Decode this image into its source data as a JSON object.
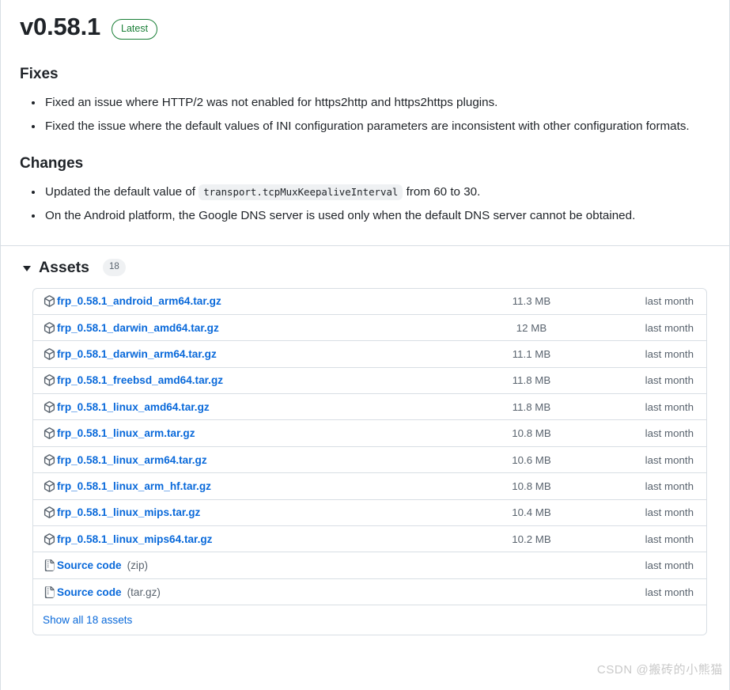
{
  "release": {
    "version": "v0.58.1",
    "badge": "Latest"
  },
  "sections": [
    {
      "heading": "Fixes",
      "items": [
        {
          "text": "Fixed an issue where HTTP/2 was not enabled for https2http and https2https plugins."
        },
        {
          "text": "Fixed the issue where the default values of INI configuration parameters are inconsistent with other configuration formats."
        }
      ]
    },
    {
      "heading": "Changes",
      "items": [
        {
          "pre": "Updated the default value of ",
          "code": "transport.tcpMuxKeepaliveInterval",
          "post": " from 60 to 30."
        },
        {
          "text": "On the Android platform, the Google DNS server is used only when the default DNS server cannot be obtained."
        }
      ]
    }
  ],
  "assets": {
    "title": "Assets",
    "count": "18",
    "show_all_label": "Show all 18 assets",
    "rows": [
      {
        "icon": "package-icon",
        "name": "frp_0.58.1_android_arm64.tar.gz",
        "suffix": "",
        "size": "11.3 MB",
        "date": "last month"
      },
      {
        "icon": "package-icon",
        "name": "frp_0.58.1_darwin_amd64.tar.gz",
        "suffix": "",
        "size": "12 MB",
        "date": "last month"
      },
      {
        "icon": "package-icon",
        "name": "frp_0.58.1_darwin_arm64.tar.gz",
        "suffix": "",
        "size": "11.1 MB",
        "date": "last month"
      },
      {
        "icon": "package-icon",
        "name": "frp_0.58.1_freebsd_amd64.tar.gz",
        "suffix": "",
        "size": "11.8 MB",
        "date": "last month"
      },
      {
        "icon": "package-icon",
        "name": "frp_0.58.1_linux_amd64.tar.gz",
        "suffix": "",
        "size": "11.8 MB",
        "date": "last month"
      },
      {
        "icon": "package-icon",
        "name": "frp_0.58.1_linux_arm.tar.gz",
        "suffix": "",
        "size": "10.8 MB",
        "date": "last month"
      },
      {
        "icon": "package-icon",
        "name": "frp_0.58.1_linux_arm64.tar.gz",
        "suffix": "",
        "size": "10.6 MB",
        "date": "last month"
      },
      {
        "icon": "package-icon",
        "name": "frp_0.58.1_linux_arm_hf.tar.gz",
        "suffix": "",
        "size": "10.8 MB",
        "date": "last month"
      },
      {
        "icon": "package-icon",
        "name": "frp_0.58.1_linux_mips.tar.gz",
        "suffix": "",
        "size": "10.4 MB",
        "date": "last month"
      },
      {
        "icon": "package-icon",
        "name": "frp_0.58.1_linux_mips64.tar.gz",
        "suffix": "",
        "size": "10.2 MB",
        "date": "last month"
      },
      {
        "icon": "file-zip-icon",
        "name": "Source code",
        "suffix": "(zip)",
        "size": "",
        "date": "last month"
      },
      {
        "icon": "file-zip-icon",
        "name": "Source code",
        "suffix": "(tar.gz)",
        "size": "",
        "date": "last month"
      }
    ]
  },
  "watermark": "CSDN @搬砖的小熊猫",
  "colors": {
    "link": "#0969da",
    "badge_green": "#1a7f37",
    "muted": "#59636e",
    "border": "#d8dee4"
  }
}
